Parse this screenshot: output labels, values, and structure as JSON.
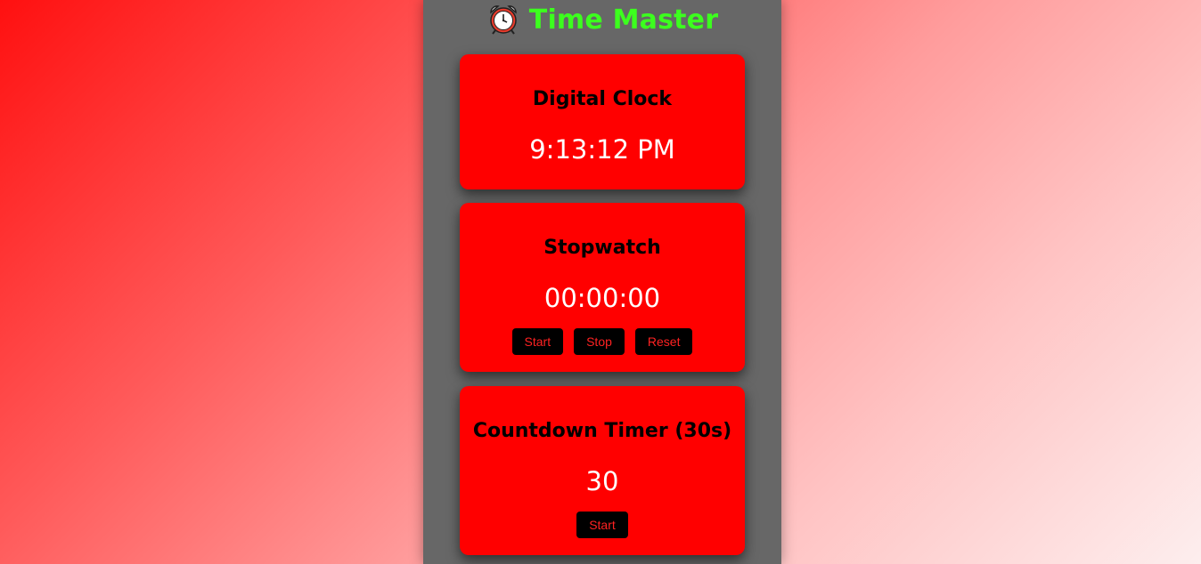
{
  "header": {
    "icon": "alarm-clock-icon",
    "title": "Time Master",
    "title_color": "#3cff1e"
  },
  "colors": {
    "panel": "#676767",
    "card": "#ff0000",
    "button_bg": "#000000",
    "button_text": "#ff2222"
  },
  "digital_clock": {
    "title": "Digital Clock",
    "time": "9:13:12 PM"
  },
  "stopwatch": {
    "title": "Stopwatch",
    "time": "00:00:00",
    "start_label": "Start",
    "stop_label": "Stop",
    "reset_label": "Reset"
  },
  "countdown": {
    "title": "Countdown Timer (30s)",
    "value": "30",
    "start_label": "Start"
  }
}
